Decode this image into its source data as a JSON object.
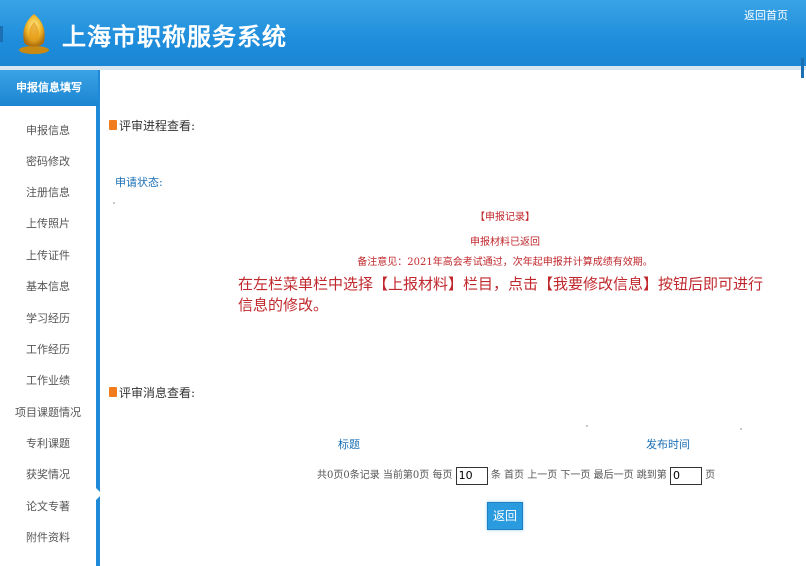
{
  "header": {
    "app_title": "上海市职称服务系统",
    "home_link": "返回首页",
    "brand_color": "#1e8ddb",
    "logo_icon": "gold-emblem-icon"
  },
  "sidebar": {
    "heading": "申报信息填写",
    "items": [
      {
        "label": "申报信息"
      },
      {
        "label": "密码修改"
      },
      {
        "label": "注册信息"
      },
      {
        "label": "上传照片"
      },
      {
        "label": "上传证件"
      },
      {
        "label": "基本信息"
      },
      {
        "label": "学习经历"
      },
      {
        "label": "工作经历"
      },
      {
        "label": "工作业绩"
      },
      {
        "label": "项目课题情况"
      },
      {
        "label": "专利课题"
      },
      {
        "label": "获奖情况"
      },
      {
        "label": "论文专著"
      },
      {
        "label": "附件资料"
      }
    ]
  },
  "review_progress": {
    "title": "评审进程查看:",
    "status_label": "申请状态:",
    "status_bracket": "【申报记录】",
    "status_text": "申报材料已返回",
    "remark": "备注意见：2021年高会考试通过，次年起申报并计算成绩有效期。",
    "instruction": "在左栏菜单栏中选择【上报材料】栏目，点击【我要修改信息】按钮后即可进行信息的修改。"
  },
  "review_messages": {
    "title": "评审消息查看:",
    "columns": [
      "标题",
      "发布时间"
    ],
    "pager": {
      "summary": "共0页0条记录 当前第0页 每页",
      "page_size": "10",
      "per_unit": "条",
      "first": "首页",
      "prev": "上一页",
      "next": "下一页",
      "last": "最后一页",
      "goto": "跳到第",
      "goto_value": "0",
      "goto_unit": "页"
    },
    "back_button": "返回"
  },
  "accent_colors": {
    "section_icon": "#f07c1e",
    "alert_text": "#c0282d",
    "link_text": "#1a6fb5"
  }
}
